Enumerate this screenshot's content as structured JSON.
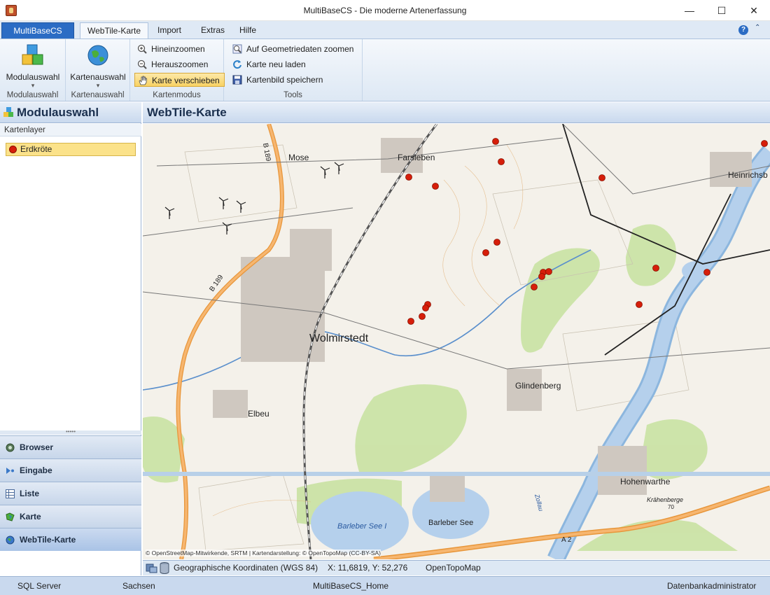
{
  "window": {
    "title": "MultiBaseCS - Die moderne Artenerfassung",
    "min_glyph": "—",
    "max_glyph": "☐",
    "close_glyph": "✕"
  },
  "ribbon_tabs": {
    "app": "MultiBaseCS",
    "tabs": [
      "WebTile-Karte",
      "Import",
      "Extras",
      "Hilfe"
    ]
  },
  "ribbon": {
    "groups": {
      "modulauswahl": {
        "label": "Modulauswahl",
        "button": "Modulauswahl",
        "arrow": "▾"
      },
      "kartenauswahl": {
        "label": "Kartenauswahl",
        "button": "Kartenauswahl",
        "arrow": "▾"
      },
      "kartenmodus": {
        "label": "Kartenmodus",
        "buttons": [
          "Hineinzoomen",
          "Herauszoomen",
          "Karte verschieben"
        ]
      },
      "tools": {
        "label": "Tools",
        "buttons": [
          "Auf Geometriedaten zoomen",
          "Karte neu laden",
          "Kartenbild speichern"
        ]
      }
    }
  },
  "left_panel": {
    "title": "Modulauswahl",
    "sub_header": "Kartenlayer",
    "layers": [
      {
        "label": "Erdkröte",
        "color": "#d61e0a"
      }
    ],
    "nav": [
      "Browser",
      "Eingabe",
      "Liste",
      "Karte",
      "WebTile-Karte"
    ],
    "splitter_glyph": "•••••"
  },
  "main": {
    "title": "WebTile-Karte"
  },
  "map": {
    "attribution": "© OpenStreetMap-Mitwirkende, SRTM | Kartendarstellung: © OpenTopoMap (CC-BY-SA)",
    "labels": {
      "wolmirstedt": "Wolmirstedt",
      "farsleben": "Farsleben",
      "mose": "Mose",
      "heinrichsberg": "Heinrichsb",
      "glindenberg": "Glindenberg",
      "elbeu": "Elbeu",
      "hohenwarthe": "Hohenwarthe",
      "barleber_see_i": "Barleber See I",
      "barleber_see": "Barleber See",
      "kraehenberge": "Krähenberge",
      "kraehenberge_elev": "70",
      "b189_north": "B 189",
      "b189_south": "B 189",
      "a2": "A 2",
      "zollau": "Zollau"
    }
  },
  "map_status": {
    "crs": "Geographische Koordinaten (WGS 84)",
    "coords": "X: 11,6819, Y: 52,276",
    "source": "OpenTopoMap"
  },
  "statusbar": {
    "server": "SQL Server",
    "region": "Sachsen",
    "database": "MultiBaseCS_Home",
    "user": "Datenbankadministrator"
  }
}
